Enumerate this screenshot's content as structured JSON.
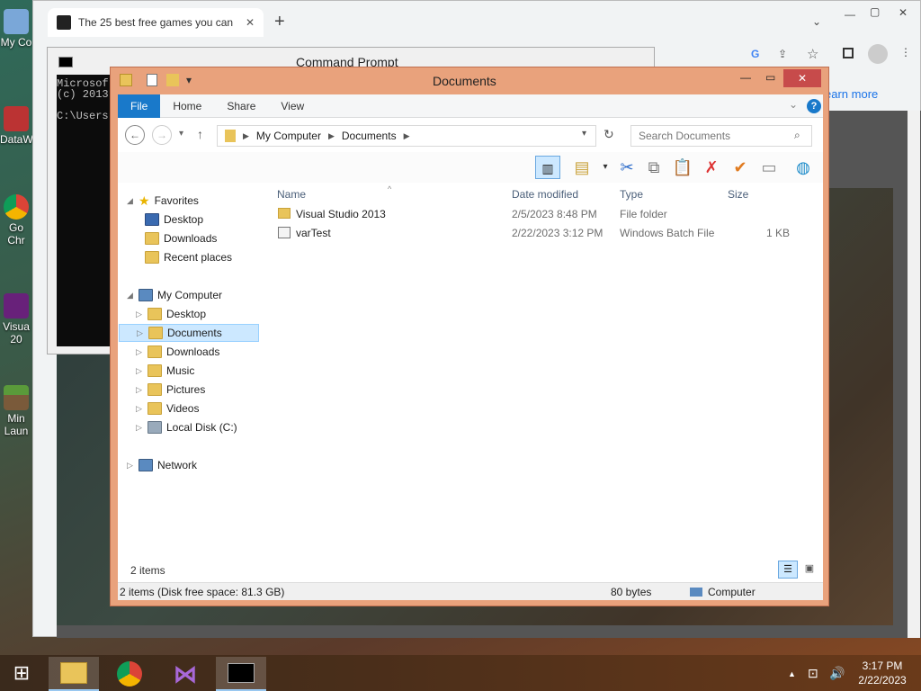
{
  "desktop": {
    "icons": [
      {
        "label": "My Co",
        "icon": "computer-icon"
      },
      {
        "label": "DataW",
        "icon": "shortcut-icon"
      },
      {
        "label": "Go Chr",
        "icon": "chrome-icon"
      },
      {
        "label": "Visua 20",
        "icon": "visual-studio-icon"
      },
      {
        "label": "Min Laun",
        "icon": "minecraft-icon"
      }
    ]
  },
  "chrome": {
    "tab_title": "The 25 best free games you can",
    "new_tab": "+",
    "learn_more": "earn more"
  },
  "cmd": {
    "title": "Command Prompt",
    "lines": [
      "Microsof",
      "(c) 2013",
      "",
      "C:\\Users"
    ]
  },
  "explorer": {
    "title": "Documents",
    "ribbon": {
      "file": "File",
      "home": "Home",
      "share": "Share",
      "view": "View"
    },
    "address": {
      "root": "My Computer",
      "current": "Documents"
    },
    "search_placeholder": "Search Documents",
    "columns": {
      "name": "Name",
      "date": "Date modified",
      "type": "Type",
      "size": "Size"
    },
    "files": [
      {
        "name": "Visual Studio 2013",
        "date": "2/5/2023 8:48 PM",
        "type": "File folder",
        "size": ""
      },
      {
        "name": "varTest",
        "date": "2/22/2023 3:12 PM",
        "type": "Windows Batch File",
        "size": "1 KB"
      }
    ],
    "nav": {
      "favorites": "Favorites",
      "fav_items": [
        "Desktop",
        "Downloads",
        "Recent places"
      ],
      "my_computer": "My Computer",
      "pc_items": [
        "Desktop",
        "Documents",
        "Downloads",
        "Music",
        "Pictures",
        "Videos",
        "Local Disk (C:)"
      ],
      "network": "Network"
    },
    "item_count": "2 items",
    "status": {
      "left": "2 items (Disk free space: 81.3 GB)",
      "size": "80 bytes",
      "location": "Computer"
    }
  },
  "taskbar": {
    "time": "3:17 PM",
    "date": "2/22/2023"
  }
}
